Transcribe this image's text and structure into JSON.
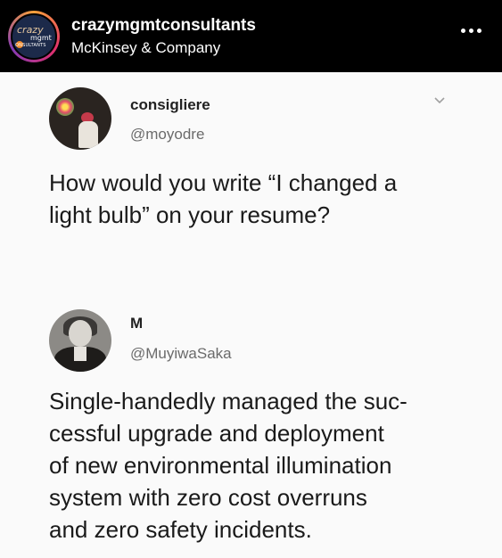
{
  "header": {
    "username": "crazymgmtconsultants",
    "subtitle": "McKinsey & Company",
    "avatar_logo": {
      "line1": "crazy",
      "line2": "mgmt",
      "line3": "ONSULTANTS"
    },
    "more_icon": "more-horizontal-icon"
  },
  "tweets": [
    {
      "name": "consigliere",
      "handle": "@moyodre",
      "text_lines": [
        "How would you write “I changed a",
        "light bulb” on your resume?"
      ]
    },
    {
      "name": "M",
      "handle": "@MuyiwaSaka",
      "text_lines": [
        "Single-handedly managed the suc-",
        "cessful upgrade and deployment",
        "of new environmental illumination",
        "system with zero cost overruns",
        "and zero safety incidents."
      ]
    }
  ],
  "colors": {
    "header_bg": "#000000",
    "post_bg": "#fafafa",
    "handle": "#6b6b6b"
  }
}
